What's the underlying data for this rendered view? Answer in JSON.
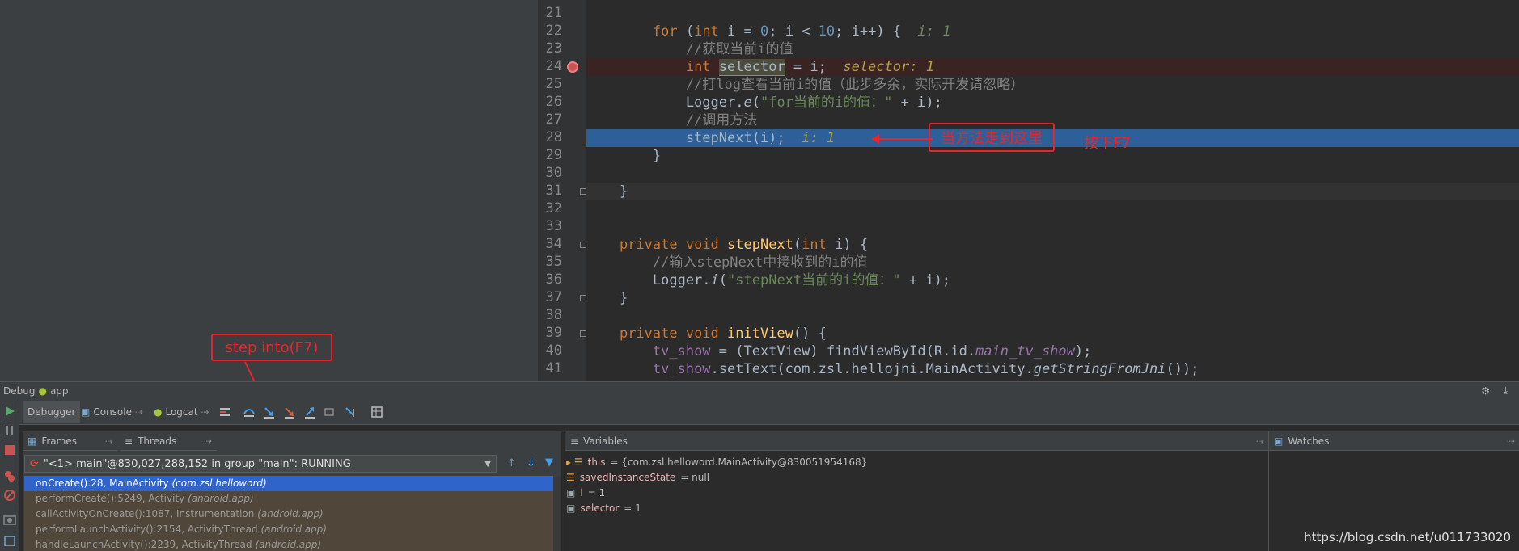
{
  "editor": {
    "lines": [
      {
        "n": "21",
        "html": ""
      },
      {
        "n": "22",
        "segments": [
          [
            "        ",
            ""
          ],
          [
            "for",
            "kw"
          ],
          [
            " (",
            ""
          ],
          [
            "int",
            "kw"
          ],
          [
            " i = ",
            ""
          ],
          [
            "0",
            "num"
          ],
          [
            "; i < ",
            ""
          ],
          [
            "10",
            "num"
          ],
          [
            "; i++) {  ",
            ""
          ],
          [
            "i: 1",
            "inline-val"
          ]
        ]
      },
      {
        "n": "23",
        "segments": [
          [
            "            //获取当前i的值",
            "cmt"
          ]
        ]
      },
      {
        "n": "24",
        "segments": [
          [
            "            ",
            ""
          ],
          [
            "int",
            "kw"
          ],
          [
            " ",
            ""
          ],
          [
            "selector",
            "sel-word"
          ],
          [
            " = i;  ",
            ""
          ],
          [
            "selector: 1",
            "inline-val-sel"
          ]
        ]
      },
      {
        "n": "25",
        "segments": [
          [
            "            //打log查看当前i的值（此步多余，实际开发请忽略）",
            "cmt"
          ]
        ]
      },
      {
        "n": "26",
        "segments": [
          [
            "            Logger.",
            ""
          ],
          [
            "e",
            "italic"
          ],
          [
            "(",
            ""
          ],
          [
            "\"for当前的i的值：\"",
            "str"
          ],
          [
            " + i);",
            ""
          ]
        ]
      },
      {
        "n": "27",
        "segments": [
          [
            "            //调用方法",
            "cmt"
          ]
        ]
      },
      {
        "n": "28",
        "segments": [
          [
            "            stepNext(i);  ",
            ""
          ],
          [
            "i: 1",
            "inline-val-sel"
          ]
        ]
      },
      {
        "n": "29",
        "segments": [
          [
            "        }",
            ""
          ]
        ]
      },
      {
        "n": "30",
        "segments": []
      },
      {
        "n": "31",
        "segments": [
          [
            "    }",
            ""
          ]
        ]
      },
      {
        "n": "32",
        "segments": []
      },
      {
        "n": "33",
        "segments": []
      },
      {
        "n": "34",
        "segments": [
          [
            "    ",
            ""
          ],
          [
            "private void ",
            "kw"
          ],
          [
            "stepNext",
            "fn"
          ],
          [
            "(",
            ""
          ],
          [
            "int",
            "kw"
          ],
          [
            " i) {",
            ""
          ]
        ]
      },
      {
        "n": "35",
        "segments": [
          [
            "        //输入stepNext中接收到的i的值",
            "cmt"
          ]
        ]
      },
      {
        "n": "36",
        "segments": [
          [
            "        Logger.",
            ""
          ],
          [
            "i",
            "italic"
          ],
          [
            "(",
            ""
          ],
          [
            "\"stepNext当前的i的值：\"",
            "str"
          ],
          [
            " + i);",
            ""
          ]
        ]
      },
      {
        "n": "37",
        "segments": [
          [
            "    }",
            ""
          ]
        ]
      },
      {
        "n": "38",
        "segments": []
      },
      {
        "n": "39",
        "segments": [
          [
            "    ",
            ""
          ],
          [
            "private void ",
            "kw"
          ],
          [
            "initView",
            "fn"
          ],
          [
            "() {",
            ""
          ]
        ]
      },
      {
        "n": "40",
        "segments": [
          [
            "        ",
            ""
          ],
          [
            "tv_show",
            "fld"
          ],
          [
            " = (TextView) findViewById(R.id.",
            ""
          ],
          [
            "main_tv_show",
            "fld italic"
          ],
          [
            ");",
            ""
          ]
        ]
      },
      {
        "n": "41",
        "segments": [
          [
            "        ",
            ""
          ],
          [
            "tv_show",
            "fld"
          ],
          [
            ".setText(com.zsl.hellojni.MainActivity.",
            ""
          ],
          [
            "getStringFromJni",
            "italic"
          ],
          [
            "());",
            ""
          ]
        ]
      }
    ]
  },
  "annotations": {
    "method_here": "当方法走到这里",
    "press_f7": "按下F7",
    "step_into": "step into(F7)"
  },
  "debug_bar": {
    "label": "Debug",
    "app": "app"
  },
  "tabs": {
    "debugger": "Debugger",
    "console": "Console",
    "logcat": "Logcat"
  },
  "frames": {
    "header": "Frames",
    "threads_header": "Threads",
    "thread": "\"<1> main\"@830,027,288,152 in group \"main\": RUNNING",
    "rows": [
      {
        "method": "onCreate():28, MainActivity ",
        "pkg": "(com.zsl.helloword)"
      },
      {
        "method": "performCreate():5249, Activity ",
        "pkg": "(android.app)"
      },
      {
        "method": "callActivityOnCreate():1087, Instrumentation ",
        "pkg": "(android.app)"
      },
      {
        "method": "performLaunchActivity():2154, ActivityThread ",
        "pkg": "(android.app)"
      },
      {
        "method": "handleLaunchActivity():2239, ActivityThread ",
        "pkg": "(android.app)"
      }
    ]
  },
  "variables": {
    "header": "Variables",
    "rows": [
      {
        "name": "this",
        "value": " = {com.zsl.helloword.MainActivity@830051954168}"
      },
      {
        "name": "savedInstanceState",
        "value": " = null"
      },
      {
        "name": "i",
        "value": " = 1"
      },
      {
        "name": "selector",
        "value": " = 1"
      }
    ]
  },
  "watches": {
    "header": "Watches"
  },
  "watermark": "https://blog.csdn.net/u011733020"
}
